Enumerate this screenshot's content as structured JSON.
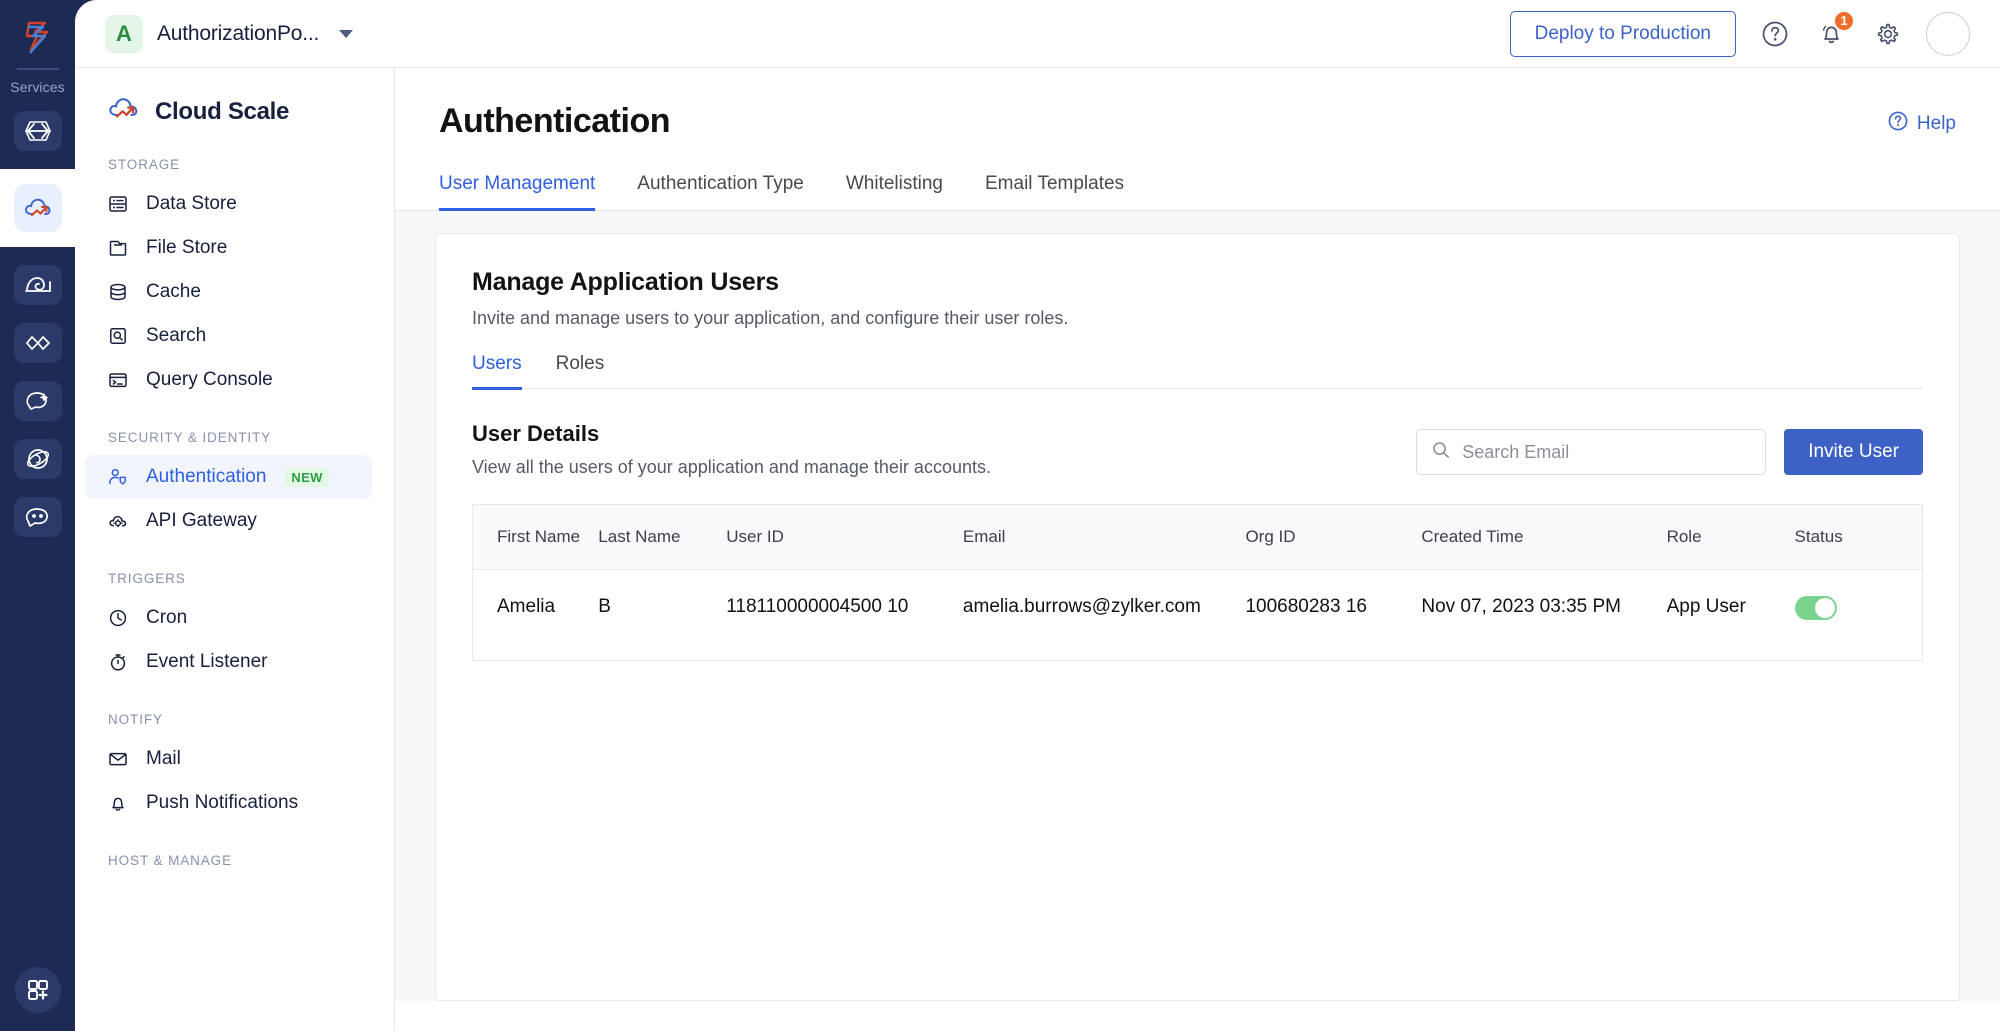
{
  "rail": {
    "label": "Services",
    "logo_icon": "zoho-catalyst-logo-icon",
    "items": [
      {
        "icon": "code-chevrons-icon",
        "name": "service-code"
      },
      {
        "icon": "cloud-scale-icon",
        "name": "service-cloud-scale",
        "active": true
      },
      {
        "icon": "serverless-icon",
        "name": "service-serverless"
      },
      {
        "icon": "link-chevrons-icon",
        "name": "service-integrations"
      },
      {
        "icon": "ai-sparkle-icon",
        "name": "service-ai"
      },
      {
        "icon": "orbit-icon",
        "name": "service-orbit"
      },
      {
        "icon": "chat-bot-icon",
        "name": "service-chatbot"
      }
    ],
    "bottom_icon": "grid-plus-icon"
  },
  "topbar": {
    "project_initial": "A",
    "project_name": "AuthorizationPo...",
    "deploy_label": "Deploy to Production",
    "help_icon": "question-circle-icon",
    "notifications_icon": "bell-icon",
    "notifications_count": "1",
    "settings_icon": "gear-icon",
    "avatar_icon": "user-avatar"
  },
  "sidebar": {
    "brand": "Cloud Scale",
    "brand_icon": "cloud-scale-logo-icon",
    "groups": [
      {
        "label": "STORAGE",
        "items": [
          {
            "label": "Data Store",
            "icon": "data-store-icon"
          },
          {
            "label": "File Store",
            "icon": "file-store-icon"
          },
          {
            "label": "Cache",
            "icon": "cache-database-icon"
          },
          {
            "label": "Search",
            "icon": "search-box-icon"
          },
          {
            "label": "Query Console",
            "icon": "query-console-icon"
          }
        ]
      },
      {
        "label": "SECURITY & IDENTITY",
        "items": [
          {
            "label": "Authentication",
            "icon": "user-shield-icon",
            "badge": "NEW",
            "active": true
          },
          {
            "label": "API Gateway",
            "icon": "api-gateway-icon"
          }
        ]
      },
      {
        "label": "TRIGGERS",
        "items": [
          {
            "label": "Cron",
            "icon": "clock-icon"
          },
          {
            "label": "Event Listener",
            "icon": "stopwatch-icon"
          }
        ]
      },
      {
        "label": "NOTIFY",
        "items": [
          {
            "label": "Mail",
            "icon": "envelope-icon"
          },
          {
            "label": "Push Notifications",
            "icon": "bell-outline-icon"
          }
        ]
      },
      {
        "label": "HOST & MANAGE",
        "items": []
      }
    ]
  },
  "main": {
    "page_title": "Authentication",
    "help_label": "Help",
    "help_icon": "question-circle-icon",
    "tabs": [
      {
        "label": "User Management",
        "active": true
      },
      {
        "label": "Authentication Type",
        "active": false
      },
      {
        "label": "Whitelisting",
        "active": false
      },
      {
        "label": "Email Templates",
        "active": false
      }
    ],
    "card": {
      "title": "Manage Application Users",
      "subtitle": "Invite and manage users to your application, and configure their user roles.",
      "subtabs": [
        {
          "label": "Users",
          "active": true
        },
        {
          "label": "Roles",
          "active": false
        }
      ],
      "section_title": "User Details",
      "section_subtitle": "View all the users of your application and manage their accounts.",
      "search_placeholder": "Search Email",
      "search_value": "",
      "search_icon": "search-icon",
      "invite_label": "Invite User",
      "table": {
        "columns": [
          "First Name",
          "Last Name",
          "User ID",
          "Email",
          "Org ID",
          "Created Time",
          "Role",
          "Status"
        ],
        "rows": [
          {
            "first_name": "Amelia",
            "last_name": "B",
            "user_id": "118110000004500 10",
            "email": "amelia.burrows@zylker.com",
            "org_id": "100680283 16",
            "created_time": "Nov 07, 2023 03:35 PM",
            "role": "App User",
            "status_enabled": true
          }
        ]
      }
    }
  },
  "colors": {
    "rail_bg": "#1d2a54",
    "accent_blue": "#2f5fe0",
    "deploy_border": "#3b63c9",
    "invite_bg": "#3d61c4",
    "toggle_on": "#7bd28c",
    "badge_orange": "#ef6c2b",
    "new_badge_green": "#2f9e44"
  }
}
